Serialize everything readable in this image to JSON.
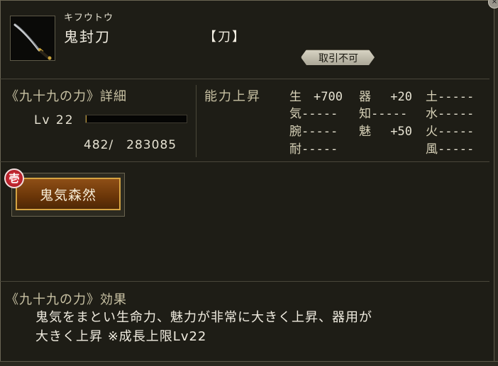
{
  "window": {
    "close_label": "×"
  },
  "item": {
    "furigana": "キフウトウ",
    "name": "鬼封刀",
    "type": "【刀】",
    "icon": "katana-icon",
    "trade_status": "取引不可"
  },
  "detail": {
    "title": "《九十九の力》詳細",
    "level": "Lv 22",
    "exp_text": "482/　283085",
    "exp_fraction": 0.0017
  },
  "stats": {
    "title": "能力上昇",
    "entries": [
      {
        "label": "生",
        "value": "+700"
      },
      {
        "label": "器",
        "value": "+20"
      },
      {
        "label": "土",
        "value": "-----"
      },
      {
        "label": "気",
        "value": "-----"
      },
      {
        "label": "知",
        "value": "-----"
      },
      {
        "label": "水",
        "value": "-----"
      },
      {
        "label": "腕",
        "value": "-----"
      },
      {
        "label": "魅",
        "value": "+50"
      },
      {
        "label": "火",
        "value": "-----"
      },
      {
        "label": "耐",
        "value": "-----"
      },
      {
        "label": "風",
        "value": "-----"
      }
    ]
  },
  "skill": {
    "badge": "壱",
    "name": "鬼気森然"
  },
  "effect": {
    "title": "《九十九の力》効果",
    "line1": "鬼気をまとい生命力、魅力が非常に大きく上昇、器用が",
    "line2": "大きく上昇 ※成長上限Lv22"
  },
  "colors": {
    "accent": "#d6a442",
    "skill_bg": "#6a3508",
    "badge_red": "#c8202a"
  }
}
